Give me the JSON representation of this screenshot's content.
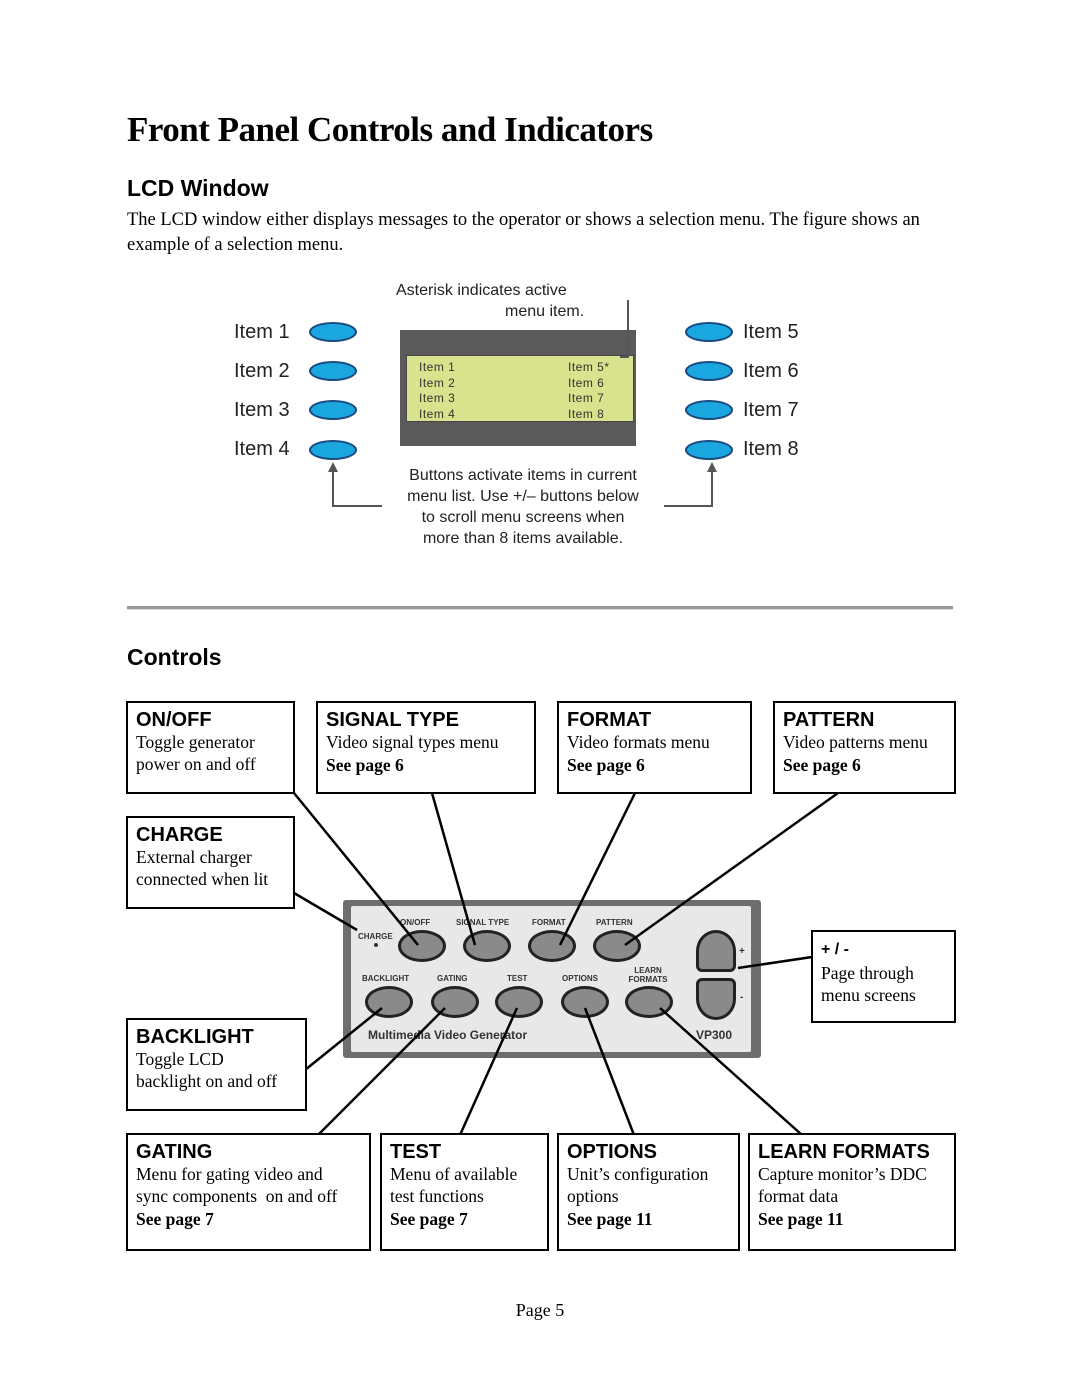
{
  "page_title": "Front Panel Controls and Indicators",
  "lcd_section": {
    "heading": "LCD Window",
    "paragraph": "The LCD window either displays messages to the operator or shows a selection menu. The figure shows an example of a selection menu."
  },
  "lcd_figure": {
    "asterisk_note_line1": "Asterisk indicates active",
    "asterisk_note_line2": "menu item.",
    "left_buttons": [
      "Item 1",
      "Item 2",
      "Item 3",
      "Item 4"
    ],
    "right_buttons": [
      "Item 5",
      "Item 6",
      "Item 7",
      "Item 8"
    ],
    "screen_left": [
      "Item 1",
      "Item 2",
      "Item 3",
      "Item 4"
    ],
    "screen_right": [
      "Item 5*",
      "Item 6",
      "Item 7",
      "Item 8"
    ],
    "bottom_note": [
      "Buttons activate items in current",
      "menu list. Use +/– buttons below",
      "to scroll menu screens when",
      "more than 8 items available."
    ],
    "button_color": "#1aa7e0",
    "lcd_color": "#d9e28c"
  },
  "controls_section": {
    "heading": "Controls",
    "boxes": {
      "onoff": {
        "title": "ON/OFF",
        "lines": [
          "Toggle generator",
          "power on and off"
        ],
        "ref": ""
      },
      "signal_type": {
        "title": "SIGNAL TYPE",
        "lines": [
          "Video signal types menu"
        ],
        "ref": "See page 6"
      },
      "format": {
        "title": "FORMAT",
        "lines": [
          "Video formats menu"
        ],
        "ref": "See page 6"
      },
      "pattern": {
        "title": "PATTERN",
        "lines": [
          "Video patterns menu"
        ],
        "ref": "See page 6"
      },
      "charge": {
        "title": "CHARGE",
        "lines": [
          "External charger",
          "connected when lit"
        ],
        "ref": ""
      },
      "plus_minus": {
        "title": "+ / -",
        "lines": [
          "Page through",
          "menu screens"
        ],
        "ref": ""
      },
      "backlight": {
        "title": "BACKLIGHT",
        "lines": [
          "Toggle LCD",
          "backlight on and off"
        ],
        "ref": ""
      },
      "gating": {
        "title": "GATING",
        "lines": [
          "Menu for gating video and",
          "sync components  on and off"
        ],
        "ref": "See page 7"
      },
      "test": {
        "title": "TEST",
        "lines": [
          "Menu of available",
          "test functions"
        ],
        "ref": "See page 7"
      },
      "options": {
        "title": "OPTIONS",
        "lines": [
          "Unit’s configuration",
          "options"
        ],
        "ref": "See page 11"
      },
      "learn_formats": {
        "title": "LEARN FORMATS",
        "lines": [
          "Capture monitor’s DDC",
          "format data"
        ],
        "ref": "See page 11"
      }
    },
    "device_panel": {
      "top_labels": [
        "ON/OFF",
        "SIGNAL TYPE",
        "FORMAT",
        "PATTERN"
      ],
      "bottom_labels": [
        "BACKLIGHT",
        "GATING",
        "TEST",
        "OPTIONS",
        "LEARN FORMATS"
      ],
      "charge_label": "CHARGE",
      "plus": "+",
      "minus": "-",
      "product_name": "Multimedia Video Generator",
      "model": "VP300"
    }
  },
  "footer": {
    "page": "Page 5"
  }
}
